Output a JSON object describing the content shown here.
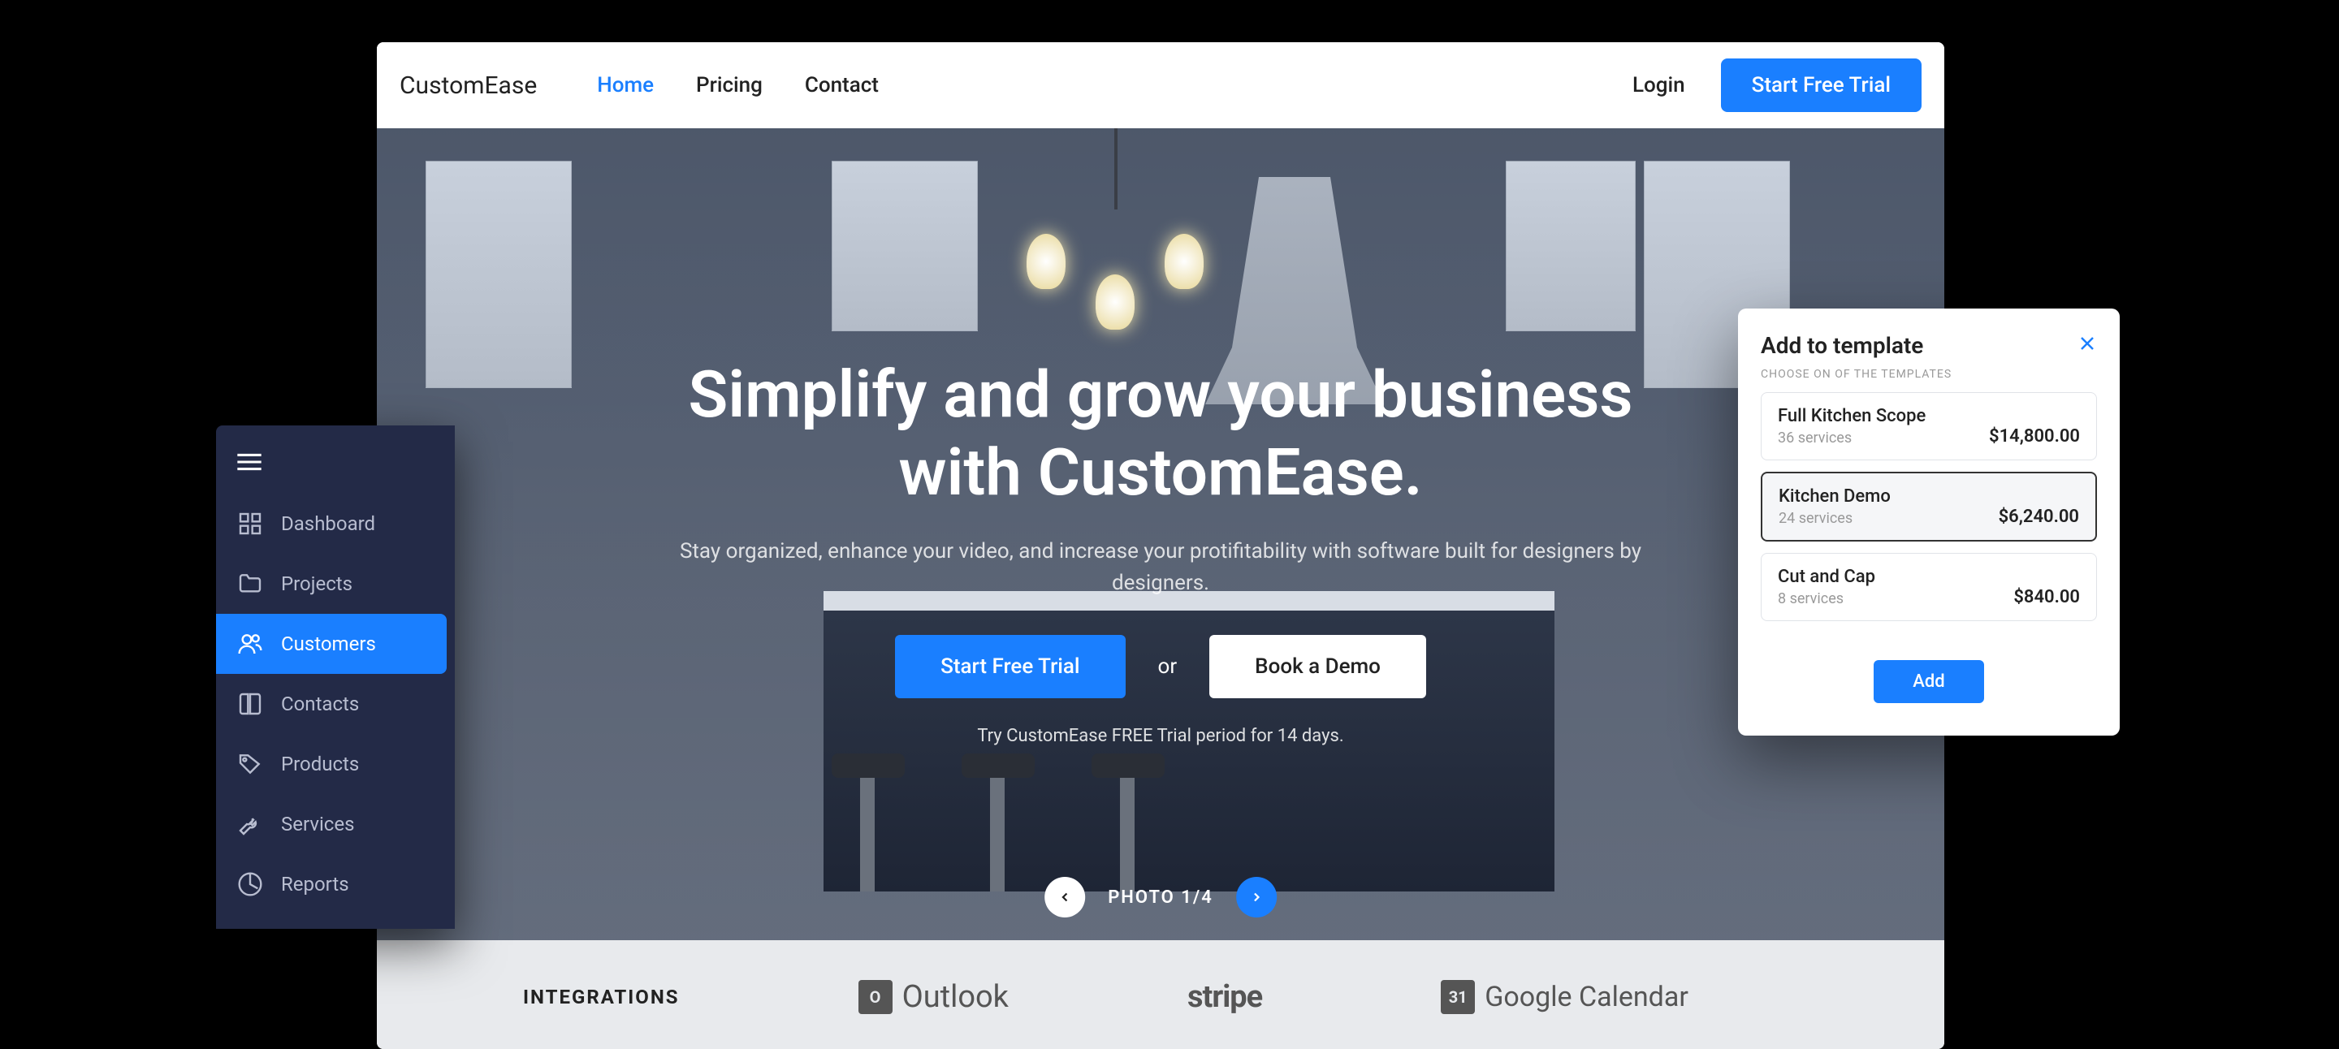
{
  "nav": {
    "brand": "CustomEase",
    "links": [
      "Home",
      "Pricing",
      "Contact"
    ],
    "login": "Login",
    "cta": "Start Free Trial"
  },
  "hero": {
    "title": "Simplify and grow your business with CustomEase.",
    "subtitle": "Stay organized, enhance your video, and increase your protifitability with software built for designers by designers.",
    "primary": "Start Free Trial",
    "or": "or",
    "secondary": "Book a Demo",
    "note": "Try CustomEase FREE Trial period for 14 days.",
    "photo_indicator": "PHOTO 1/4"
  },
  "integrations": {
    "label": "INTEGRATIONS",
    "items": [
      "Outlook",
      "stripe",
      "Google Calendar"
    ]
  },
  "sidebar": {
    "items": [
      {
        "label": "Dashboard"
      },
      {
        "label": "Projects"
      },
      {
        "label": "Customers"
      },
      {
        "label": "Contacts"
      },
      {
        "label": "Products"
      },
      {
        "label": "Services"
      },
      {
        "label": "Reports"
      }
    ]
  },
  "modal": {
    "title": "Add to template",
    "subtitle": "CHOOSE ON OF THE TEMPLATES",
    "templates": [
      {
        "name": "Full Kitchen Scope",
        "meta": "36 services",
        "price": "$14,800.00"
      },
      {
        "name": "Kitchen Demo",
        "meta": "24 services",
        "price": "$6,240.00"
      },
      {
        "name": "Cut and Cap",
        "meta": "8 services",
        "price": "$840.00"
      }
    ],
    "add": "Add"
  }
}
